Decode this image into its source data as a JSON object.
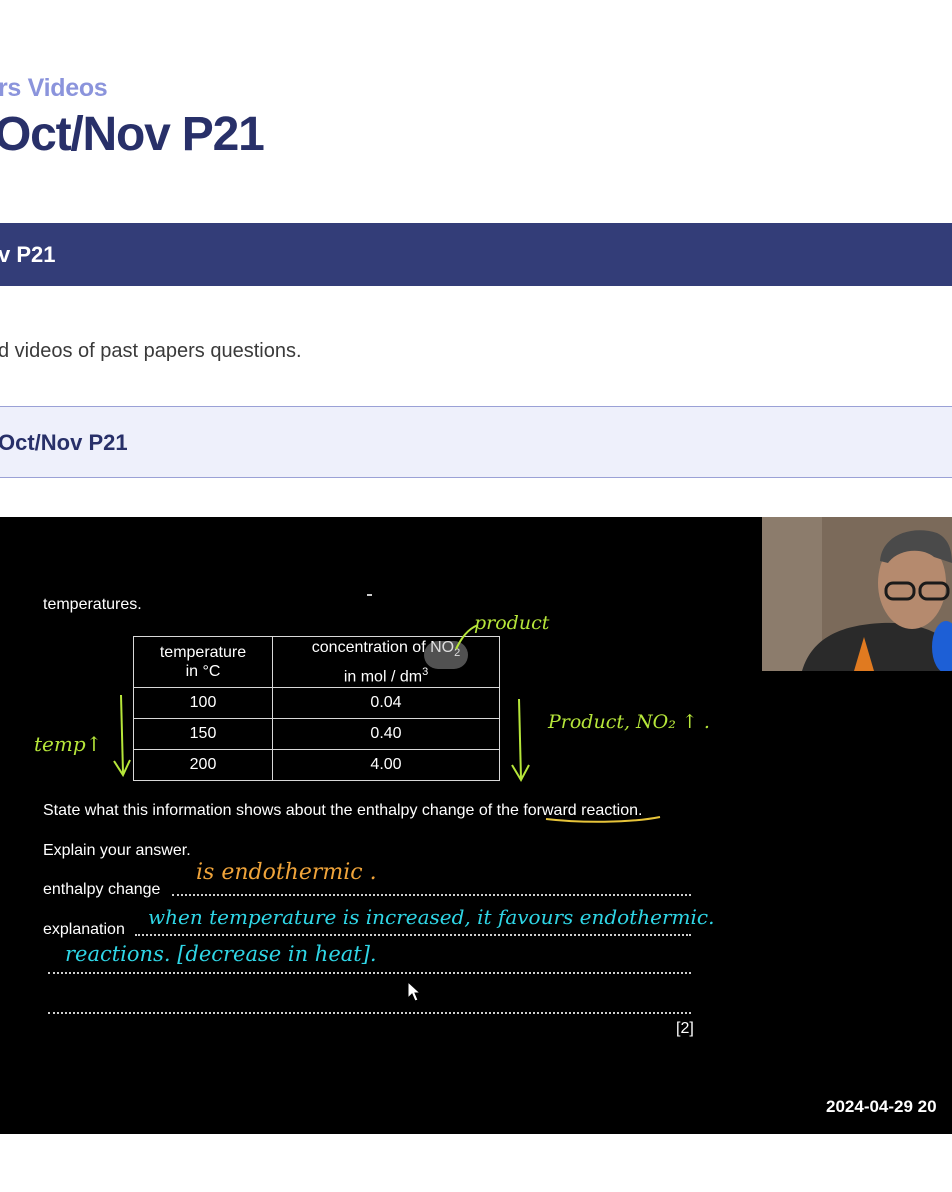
{
  "header": {
    "breadcrumb": "rs Videos",
    "title": "Oct/Nov P21"
  },
  "banner": {
    "title": "v P21"
  },
  "intro": {
    "text": "d videos of past papers questions."
  },
  "accordion": {
    "label": "Oct/Nov P21"
  },
  "video": {
    "question": {
      "intro": "temperatures.",
      "table": {
        "headers": {
          "temp_line1": "temperature",
          "temp_line2": "in °C",
          "conc_line1": "concentration of NO",
          "conc_sub": "2",
          "conc_line2": "in mol / dm",
          "conc_sup": "3"
        },
        "rows": [
          {
            "temperature": "100",
            "concentration": "0.04"
          },
          {
            "temperature": "150",
            "concentration": "0.40"
          },
          {
            "temperature": "200",
            "concentration": "4.00"
          }
        ]
      },
      "prompt_pre": "State what this information shows about the enthalpy change of the ",
      "prompt_underlined": "forward reaction",
      "prompt_post": ".",
      "explain": "Explain your answer.",
      "enthalpy_label": "enthalpy change",
      "explanation_label": "explanation",
      "marks": "[2]"
    },
    "annotations": {
      "product": "product",
      "temp_up": "temp↑",
      "product_no2": "Product, NO₂ ↑ .",
      "endothermic": "is    endothermic .",
      "explanation_line1": "when temperature is increased, it favours endothermic.",
      "explanation_line2": "reactions. [decrease in heat]."
    },
    "timestamp": "2024-04-29  20",
    "colors": {
      "green_ink": "#b6e63a",
      "orange_ink": "#f0a43a",
      "cyan_ink": "#2fd6e6",
      "underline": "#e7c43a"
    }
  }
}
